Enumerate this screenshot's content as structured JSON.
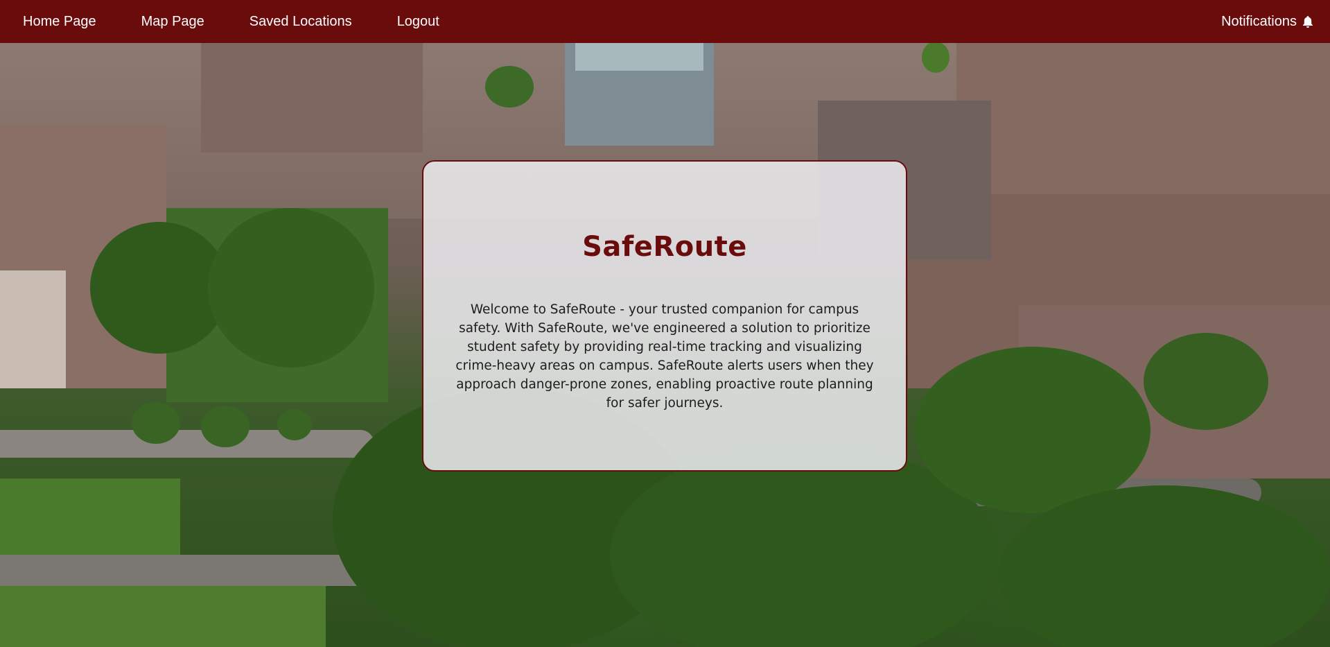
{
  "nav": {
    "items": [
      {
        "label": "Home Page"
      },
      {
        "label": "Map Page"
      },
      {
        "label": "Saved Locations"
      },
      {
        "label": "Logout"
      }
    ],
    "notifications_label": "Notifications",
    "notifications_icon": "bell-icon"
  },
  "card": {
    "title": "SafeRoute",
    "body": "Welcome to SafeRoute - your trusted companion for campus safety. With SafeRoute, we've engineered a solution to prioritize student safety by providing real-time tracking and visualizing crime-heavy areas on campus. SafeRoute alerts users when they approach danger-prone zones, enabling proactive route planning for safer journeys."
  },
  "colors": {
    "brand": "#6b0c0c",
    "nav_text": "#ffffff",
    "card_background": "#ececf0"
  },
  "background": {
    "icon": "aerial-campus-photo"
  }
}
